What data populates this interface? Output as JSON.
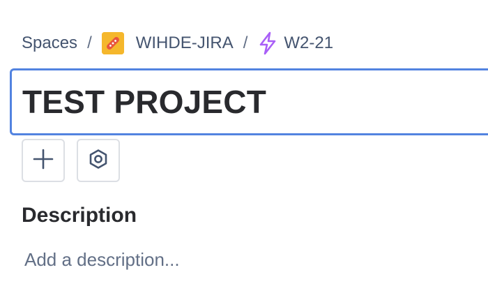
{
  "breadcrumb": {
    "spaces_label": "Spaces",
    "separator": "/",
    "space_name": "WIHDE-JIRA",
    "issue_key": "W2-21"
  },
  "issue": {
    "title": "TEST PROJECT"
  },
  "toolbar": {
    "add_icon": "plus-icon",
    "apps_icon": "hexagon-nut-icon"
  },
  "description": {
    "heading": "Description",
    "placeholder": "Add a description..."
  },
  "colors": {
    "focus_border": "#5283e0",
    "space_avatar": "#f5b72c",
    "issue_type_icon": "#a95ff7"
  }
}
